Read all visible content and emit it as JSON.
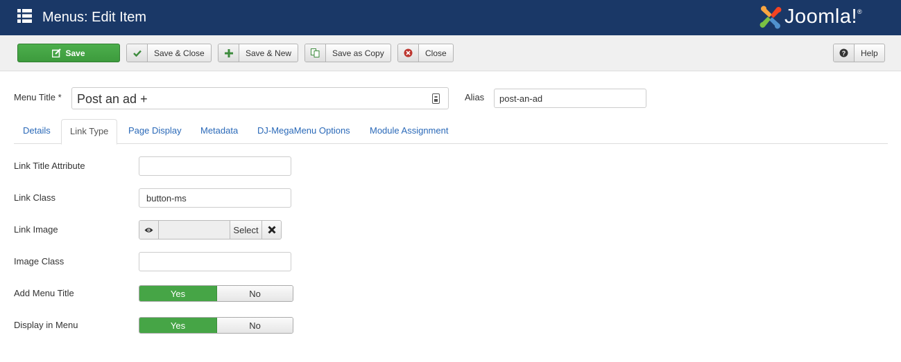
{
  "header": {
    "title": "Menus: Edit Item",
    "logo_text": "Joomla!",
    "logo_reg": "®",
    "menu_icon": "list-icon",
    "background": "#1a3867"
  },
  "toolbar": {
    "save_label": "Save",
    "save_close_label": "Save & Close",
    "save_new_label": "Save & New",
    "save_copy_label": "Save as Copy",
    "close_label": "Close",
    "help_label": "Help",
    "accent_green": "#46a546"
  },
  "form": {
    "menu_title_label": "Menu Title *",
    "menu_title_value": "Post an ad +",
    "alias_label": "Alias",
    "alias_value": "post-an-ad"
  },
  "tabs": [
    {
      "label": "Details"
    },
    {
      "label": "Link Type"
    },
    {
      "label": "Page Display"
    },
    {
      "label": "Metadata"
    },
    {
      "label": "DJ-MegaMenu Options"
    },
    {
      "label": "Module Assignment"
    }
  ],
  "active_tab": "Link Type",
  "fields": {
    "link_title_attr_label": "Link Title Attribute",
    "link_title_attr_value": "",
    "link_class_label": "Link Class",
    "link_class_value": "button-ms",
    "link_image_label": "Link Image",
    "link_image_select": "Select",
    "image_class_label": "Image Class",
    "image_class_value": "",
    "add_menu_title_label": "Add Menu Title",
    "add_menu_title_selected": "Yes",
    "display_in_menu_label": "Display in Menu",
    "display_in_menu_selected": "Yes",
    "yes_label": "Yes",
    "no_label": "No"
  }
}
